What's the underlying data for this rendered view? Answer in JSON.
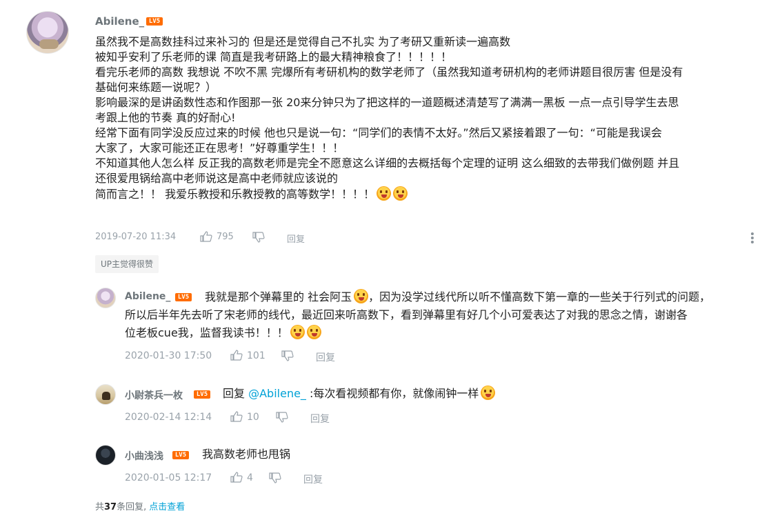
{
  "main": {
    "username": "Abilene_",
    "level": "LV5",
    "lines": [
      "虽然我不是高数挂科过来补习的 但是还是觉得自己不扎实 为了考研又重新读一遍高数",
      "被知乎安利了乐老师的课 简直是我考研路上的最大精神粮食了！！！！！",
      "看完乐老师的高数 我想说 不吹不黑 完爆所有考研机构的数学老师了（虽然我知道考研机构的老师讲题目很厉害 但是没有",
      "基础何来练题一说呢？）",
      "影响最深的是讲函数性态和作图那一张 20来分钟只为了把这样的一道题概述清楚写了满满一黑板 一点一点引导学生去思",
      "考跟上他的节奏 真的好耐心!",
      "经常下面有同学没反应过来的时候 他也只是说一句：“同学们的表情不太好。”然后又紧接着跟了一句：“可能是我误会",
      "大家了，大家可能还正在思考！”好尊重学生！！！",
      "不知道其他人怎么样 反正我的高数老师是完全不愿意这么详细的去概括每个定理的证明 这么细致的去带我们做例题 并且",
      "还很爱甩锅给高中老师说这是高中老师就应该说的",
      "简而言之！！ 我爱乐教授和乐教授教的高等数学！！！！"
    ],
    "time": "2019-07-20 11:34",
    "likes": "795",
    "reply_label": "回复",
    "up_badge": "UP主觉得很赞"
  },
  "replies": [
    {
      "username": "Abilene_",
      "level": "LV5",
      "lines": [
        "我就是那个弹幕里的 社会阿玉",
        "，因为没学过线代所以听不懂高数下第一章的一些关于行列式的问题，",
        "所以后半年先去听了宋老师的线代，最近回来听高数下，看到弹幕里有好几个小可爱表达了对我的思念之情，谢谢各",
        "位老板cue我，监督我读书！！！"
      ],
      "time": "2020-01-30 17:50",
      "likes": "101",
      "reply_label": "回复"
    },
    {
      "username": "小尉茶兵一枚",
      "level": "LV5",
      "prefix": "回复",
      "mention": "@Abilene_",
      "text": ":每次看视频都有你，就像闹钟一样",
      "time": "2020-02-14 12:14",
      "likes": "10",
      "reply_label": "回复"
    },
    {
      "username": "小曲浅浅",
      "level": "LV5",
      "text": "我高数老师也甩锅",
      "time": "2020-01-05 12:17",
      "likes": "4",
      "reply_label": "回复"
    }
  ],
  "footer": {
    "prefix": "共",
    "count": "37",
    "suffix": "条回复,",
    "see_all": "点击查看"
  }
}
